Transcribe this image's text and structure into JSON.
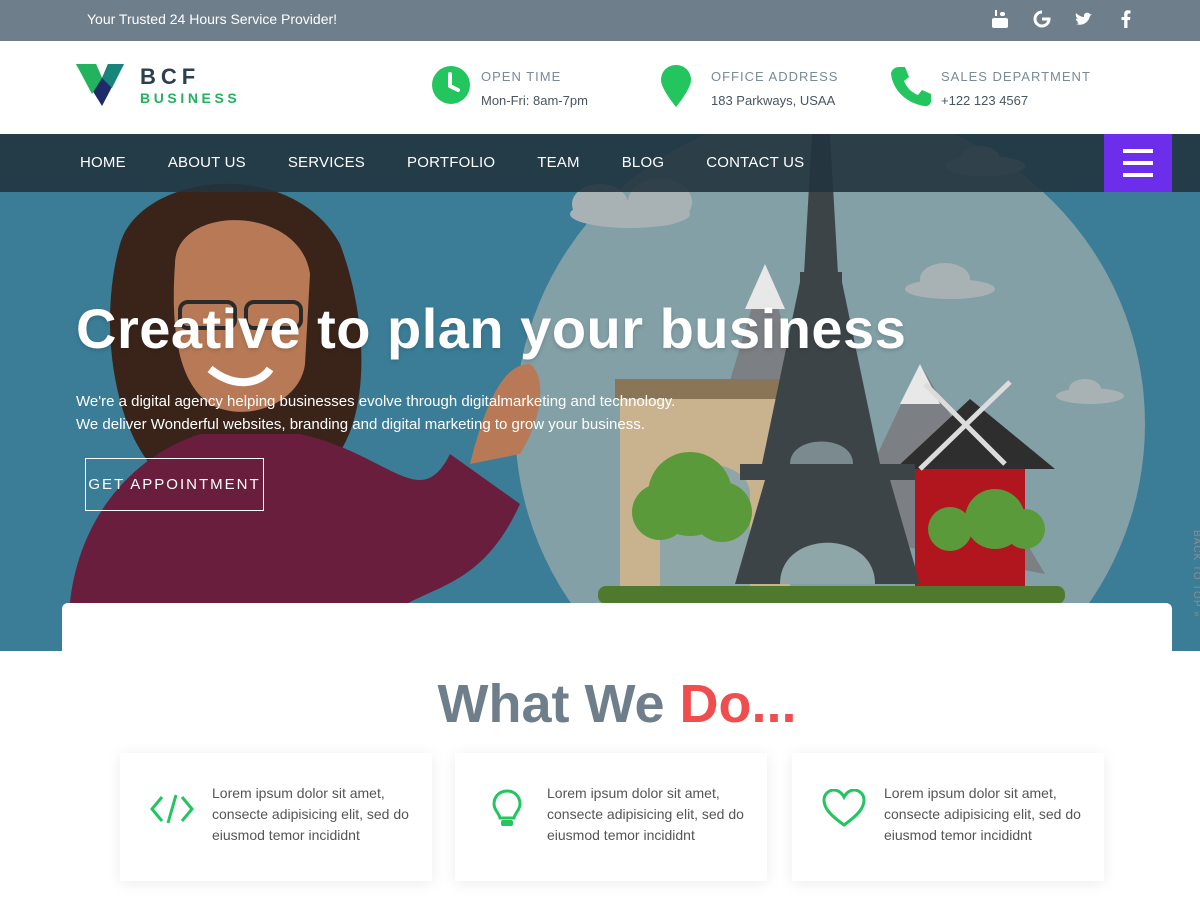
{
  "topbar": {
    "tagline": "Your Trusted 24 Hours Service Provider!",
    "social": [
      "youtube-icon",
      "google-icon",
      "twitter-icon",
      "facebook-icon"
    ]
  },
  "brand": {
    "name": "BCF",
    "sub": "BUSINESS"
  },
  "info": {
    "open_time": {
      "label": "OPEN TIME",
      "value": "Mon-Fri: 8am-7pm"
    },
    "office": {
      "label": "OFFICE ADDRESS",
      "value": "183 Parkways, USAA"
    },
    "sales": {
      "label": "SALES DEPARTMENT",
      "value": "+122 123 4567"
    }
  },
  "nav": {
    "items": [
      "HOME",
      "ABOUT US",
      "SERVICES",
      "PORTFOLIO",
      "TEAM",
      "BLOG",
      "CONTACT US"
    ]
  },
  "hero": {
    "title": "Creative to plan your business",
    "line1": "We're a digital agency helping businesses evolve through digitalmarketing and technology.",
    "line2": "We deliver Wonderful websites, branding and digital marketing to grow your business.",
    "cta": "GET APPOINTMENT",
    "back_to_top": "BACK TO TOP »"
  },
  "what_we_do": {
    "title_main": "What We",
    "title_accent": "Do...",
    "cards": [
      {
        "icon": "code-icon",
        "text": "Lorem ipsum dolor sit amet, consecte adipisicing elit, sed do eiusmod temor incididnt"
      },
      {
        "icon": "lightbulb-icon",
        "text": "Lorem ipsum dolor sit amet, consecte adipisicing elit, sed do eiusmod temor incididnt"
      },
      {
        "icon": "heart-icon",
        "text": "Lorem ipsum dolor sit amet, consecte adipisicing elit, sed do eiusmod temor incididnt"
      }
    ]
  },
  "colors": {
    "topbar": "#6e7e8a",
    "nav_bg": "#22343f",
    "menu_button": "#6c2eeb",
    "accent_green": "#22b35e",
    "accent_red": "#f04e4e",
    "hero_bg": "#3b7d97"
  }
}
